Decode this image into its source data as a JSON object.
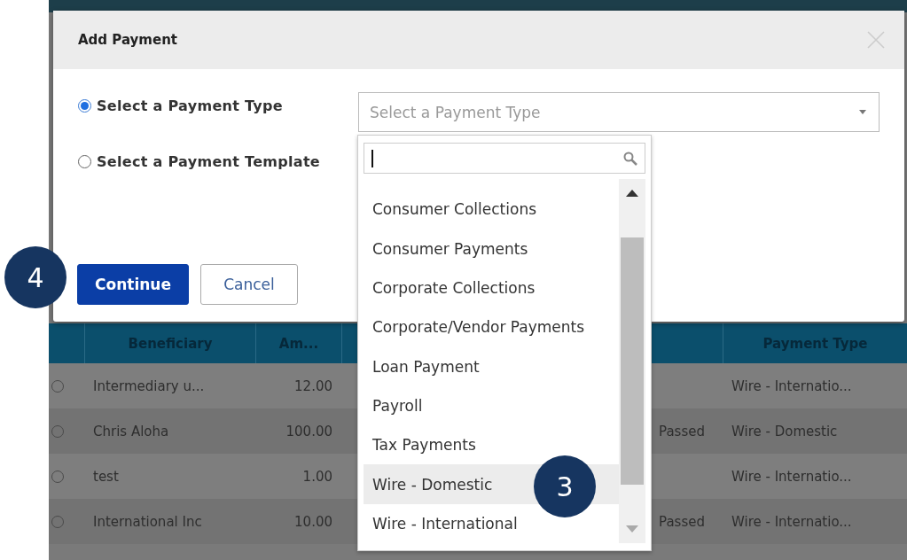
{
  "modal": {
    "title": "Add Payment",
    "options": [
      {
        "label": "Select a Payment Type",
        "selected": true
      },
      {
        "label": "Select a Payment Template",
        "selected": false
      }
    ],
    "select": {
      "placeholder": "Select a Payment Type"
    },
    "buttons": [
      {
        "label": "Continue",
        "kind": "primary"
      },
      {
        "label": "Cancel",
        "kind": "secondary"
      }
    ]
  },
  "dropdown": {
    "items": [
      {
        "label": "Consumer Collections",
        "selected": false
      },
      {
        "label": "Consumer Payments",
        "selected": false
      },
      {
        "label": "Corporate Collections",
        "selected": false
      },
      {
        "label": "Corporate/Vendor Payments",
        "selected": false
      },
      {
        "label": "Loan Payment",
        "selected": false
      },
      {
        "label": "Payroll",
        "selected": false
      },
      {
        "label": "Tax Payments",
        "selected": false
      },
      {
        "label": "Wire - Domestic",
        "selected": true
      },
      {
        "label": "Wire - International",
        "selected": false
      }
    ]
  },
  "table": {
    "columns": {
      "beneficiary": "Beneficiary",
      "amount": "Am...",
      "payment_type": "Payment Type"
    },
    "rows": [
      {
        "selected": false,
        "beneficiary": "Intermediary u...",
        "amount": "12.00",
        "payment_type": "Wire - Internatio..."
      },
      {
        "selected": false,
        "beneficiary": "Chris Aloha",
        "amount": "100.00",
        "column_4": "Passed",
        "payment_type": "Wire - Domestic"
      },
      {
        "selected": false,
        "beneficiary": "test",
        "amount": "1.00",
        "payment_type": "Wire - Internatio..."
      },
      {
        "selected": false,
        "beneficiary": "International Inc",
        "amount": "10.00",
        "column_4": "Passed",
        "payment_type": "Wire - Internatio..."
      }
    ]
  },
  "steps": [
    {
      "label": "4"
    },
    {
      "label": "3"
    }
  ]
}
